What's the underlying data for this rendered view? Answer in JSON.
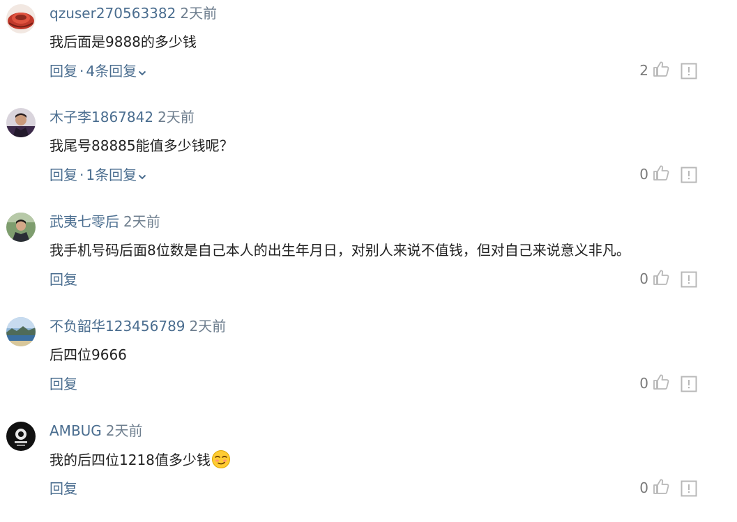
{
  "comments": [
    {
      "username": "qzuser270563382",
      "time": "2天前",
      "content": "我后面是9888的多少钱",
      "reply_label": "回复",
      "separator": "·",
      "more_replies": "4条回复",
      "likes": "2",
      "avatar": "red-hat-avatar"
    },
    {
      "username": "木子李1867842",
      "time": "2天前",
      "content": "我尾号88885能值多少钱呢？",
      "reply_label": "回复",
      "separator": "·",
      "more_replies": "1条回复",
      "likes": "0",
      "avatar": "man-portrait-avatar"
    },
    {
      "username": "武夷七零后",
      "time": "2天前",
      "content": "我手机号码后面8位数是自己本人的出生年月日，对别人来说不值钱，但对自己来说意义非凡。",
      "reply_label": "回复",
      "likes": "0",
      "avatar": "man-outdoor-avatar"
    },
    {
      "username": "不负韶华123456789",
      "time": "2天前",
      "content": "后四位9666",
      "reply_label": "回复",
      "likes": "0",
      "avatar": "landscape-avatar"
    },
    {
      "username": "AMBUG",
      "time": "2天前",
      "content": "我的后四位1218值多少钱",
      "content_emoji": "smirk-emoji",
      "reply_label": "回复",
      "likes": "0",
      "avatar": "black-logo-avatar"
    }
  ],
  "icons": {
    "like": "thumbs-up-icon",
    "report": "report-icon",
    "expand": "chevron-down-icon"
  },
  "colors": {
    "username": "#4a6d8f",
    "time": "#6f7f8f",
    "content": "#222222",
    "action": "#4a6d8f",
    "icon": "#b8b8b8"
  }
}
